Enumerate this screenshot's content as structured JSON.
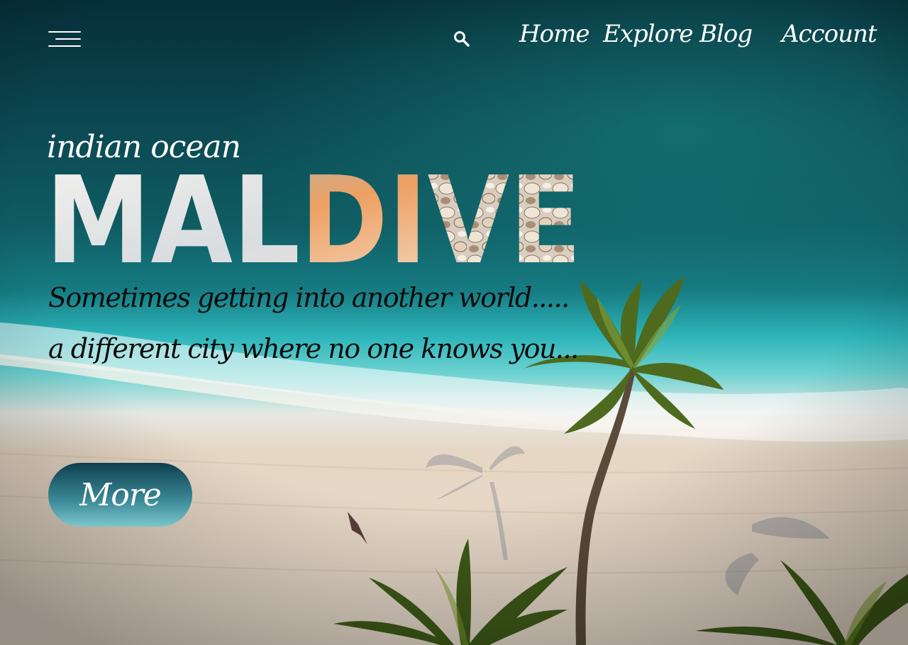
{
  "nav": {
    "menu_icon": "hamburger-menu-icon",
    "search_icon": "search-icon",
    "links": [
      {
        "label": "Home"
      },
      {
        "label": "Explore"
      },
      {
        "label": "Blog"
      },
      {
        "label": "Account"
      }
    ]
  },
  "hero": {
    "kicker": "indian ocean",
    "title": "MALDIVE",
    "tagline_line1": "Sometimes getting into another world.....",
    "tagline_line2": "a different city where no one knows you...",
    "cta_label": "More"
  },
  "colors": {
    "deep_ocean": "#0a3b44",
    "lagoon": "#2fb8bf",
    "sand": "#e6d6c4",
    "palm": "#4d6a1e",
    "button_top": "#0f3f4e",
    "button_bottom": "#7cc6cc",
    "nav_text": "#ffffff",
    "tagline_text": "#0c0c0c"
  }
}
